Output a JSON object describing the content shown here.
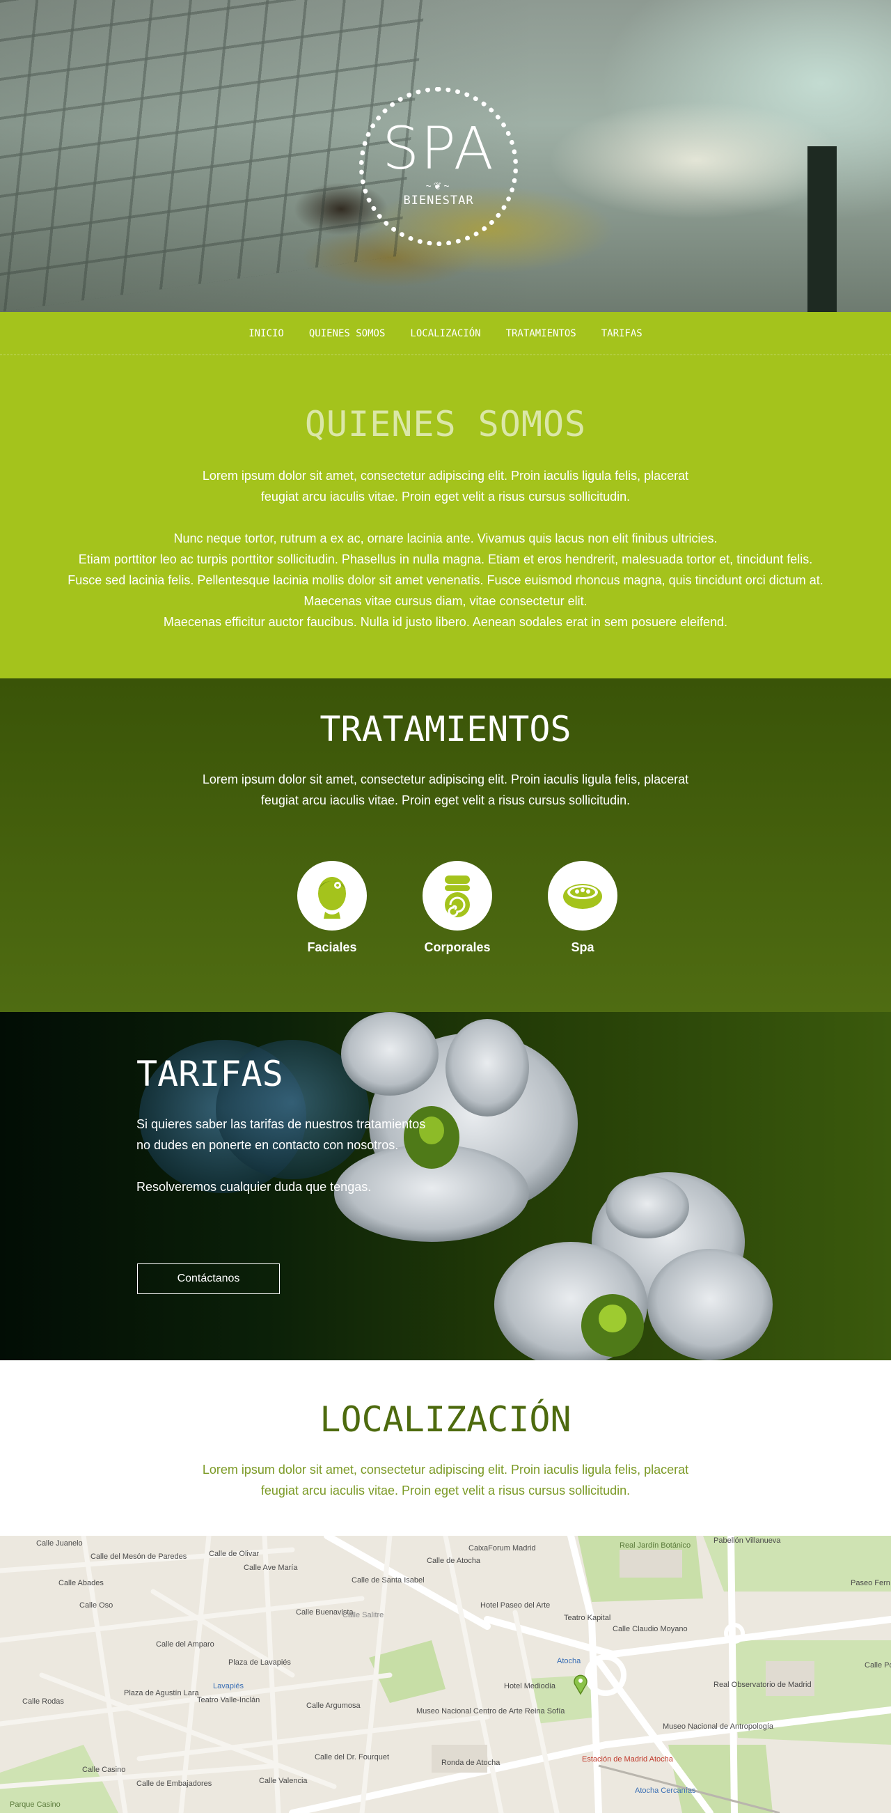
{
  "logo": {
    "title": "SPA",
    "subtitle": "BIENESTAR",
    "ornament": "~❦~"
  },
  "nav": {
    "items": [
      "INICIO",
      "QUIENES SOMOS",
      "LOCALIZACIÓN",
      "TRATAMIENTOS",
      "TARIFAS"
    ]
  },
  "quienes": {
    "title": "QUIENES SOMOS",
    "p1": [
      "Lorem ipsum dolor sit amet, consectetur adipiscing elit. Proin iaculis ligula felis, placerat",
      "feugiat arcu iaculis vitae. Proin eget velit a risus cursus sollicitudin."
    ],
    "p2": [
      "Nunc neque tortor, rutrum a ex ac, ornare lacinia ante. Vivamus quis lacus non elit finibus ultricies.",
      "Etiam porttitor leo ac turpis porttitor sollicitudin. Phasellus in nulla magna. Etiam et eros hendrerit, malesuada tortor et, tincidunt felis.",
      "Fusce sed lacinia felis. Pellentesque lacinia mollis dolor sit amet venenatis. Fusce euismod rhoncus magna, quis tincidunt orci dictum at.",
      "Maecenas vitae cursus diam, vitae consectetur elit.",
      "Maecenas efficitur auctor faucibus. Nulla id justo libero. Aenean sodales erat in sem posuere eleifend."
    ]
  },
  "tratamientos": {
    "title": "TRATAMIENTOS",
    "p": [
      "Lorem ipsum dolor sit amet, consectetur adipiscing elit. Proin iaculis ligula felis, placerat",
      "feugiat arcu iaculis vitae. Proin eget velit a risus cursus sollicitudin."
    ],
    "items": [
      {
        "label": "Faciales",
        "icon": "face-mask-icon"
      },
      {
        "label": "Corporales",
        "icon": "towel-roll-icon"
      },
      {
        "label": "Spa",
        "icon": "spa-bowl-icon"
      }
    ]
  },
  "tarifas": {
    "title": "TARIFAS",
    "p1": [
      "Si quieres saber las tarifas de nuestros tratamientos",
      "no dudes en ponerte en contacto con nosotros."
    ],
    "p2": "Resolveremos cualquier duda que tengas.",
    "button": "Contáctanos"
  },
  "localizacion": {
    "title": "LOCALIZACIÓN",
    "p": [
      "Lorem ipsum dolor sit amet, consectetur adipiscing elit. Proin iaculis ligula felis, placerat",
      "feugiat arcu iaculis vitae. Proin eget velit a risus cursus sollicitudin."
    ]
  },
  "map": {
    "labels": [
      "Calle Juanelo",
      "Calle Abades",
      "Calle Oso",
      "Calle de Olivar",
      "Calle Ave María",
      "Calle Buenavista",
      "Calle de Santa Isabel",
      "Calle de Atocha",
      "CaixaForum Madrid",
      "Real Jardín Botánico",
      "Pabellón Villanueva",
      "Hotel Paseo del Arte",
      "Teatro Kapital",
      "Calle Claudio Moyano",
      "Atocha",
      "Hotel Mediodía",
      "Real Observatorio de Madrid",
      "Museo Nacional de Antropología",
      "Plaza de Lavapiés",
      "Lavapiés",
      "Teatro Valle-Inclán",
      "Plaza de Agustín Lara",
      "Calle Argumosa",
      "Museo Nacional Centro de Arte Reina Sofía",
      "Calle Rodas",
      "Calle del Amparo",
      "Calle Casino",
      "Parque Casino",
      "Calle del Dr. Fourquet",
      "Ronda de Atocha",
      "Estación de Madrid Atocha",
      "Atocha Cercanías",
      "Paseo Fern",
      "Calle de Embajadores",
      "Calle Valencia",
      "Calle del Mesón de Paredes",
      "Calle Salitre",
      "Calle Po"
    ]
  }
}
